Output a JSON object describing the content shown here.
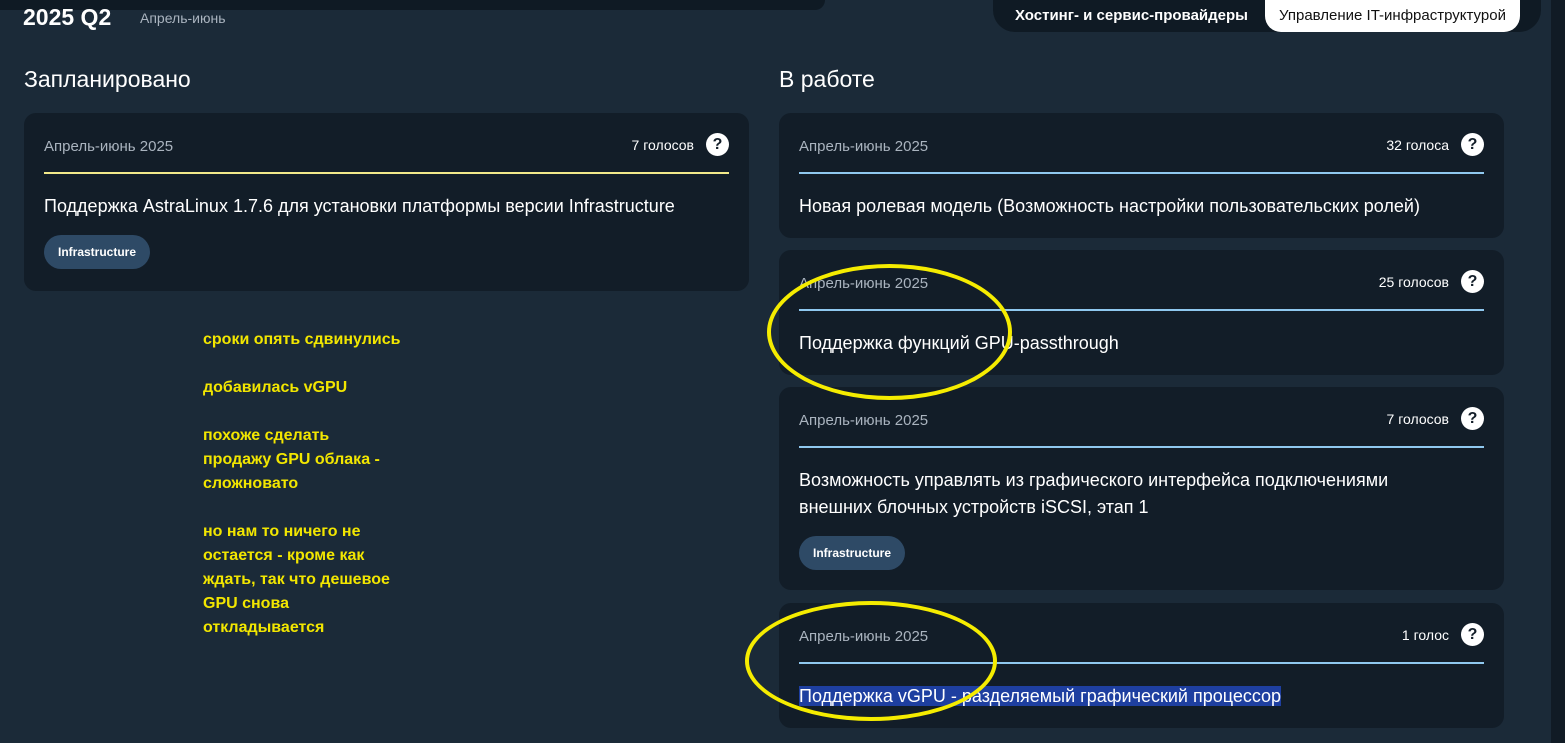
{
  "header": {
    "quarter": "2025 Q2",
    "range": "Апрель-июнь",
    "filters": [
      "Хостинг- и сервис-провайдеры",
      "Управление IT-инфраструктурой"
    ]
  },
  "columns": {
    "planned_title": "Запланировано",
    "in_progress_title": "В работе"
  },
  "planned": [
    {
      "date": "Апрель-июнь 2025",
      "votes": "7 голосов",
      "title": "Поддержка AstraLinux 1.7.6 для установки платформы версии Infrastructure",
      "tag": "Infrastructure"
    }
  ],
  "in_progress": [
    {
      "date": "Апрель-июнь 2025",
      "votes": "32 голоса",
      "title": "Новая ролевая модель (Возможность настройки пользовательских ролей)"
    },
    {
      "date": "Апрель-июнь 2025",
      "votes": "25 голосов",
      "title": "Поддержка функций GPU-passthrough"
    },
    {
      "date": "Апрель-июнь 2025",
      "votes": "7 голосов",
      "title_line1": "Возможность управлять из графического интерфейса подключениями",
      "title_line2": "внешних блочных устройств iSCSI, этап 1",
      "tag": "Infrastructure"
    },
    {
      "date": "Апрель-июнь 2025",
      "votes": "1 голос",
      "title": "Поддержка vGPU - разделяемый графический процессор"
    }
  ],
  "help_glyph": "?",
  "annotation": [
    "сроки опять сдвинулись",
    "добавилась vGPU",
    "похоже сделать\nпродажу GPU облака -\nсложновато",
    "но нам то ничего не\nостается - кроме как\nждать, так что дешевое\nGPU снова\nоткладывается"
  ],
  "colors": {
    "background": "#1b2a38",
    "card": "#121d28",
    "planned_line": "#f2e98a",
    "progress_line": "#8fc8ef",
    "annotation": "#f2e600",
    "tag": "#2e4a66",
    "selection": "#1e3fa0"
  }
}
